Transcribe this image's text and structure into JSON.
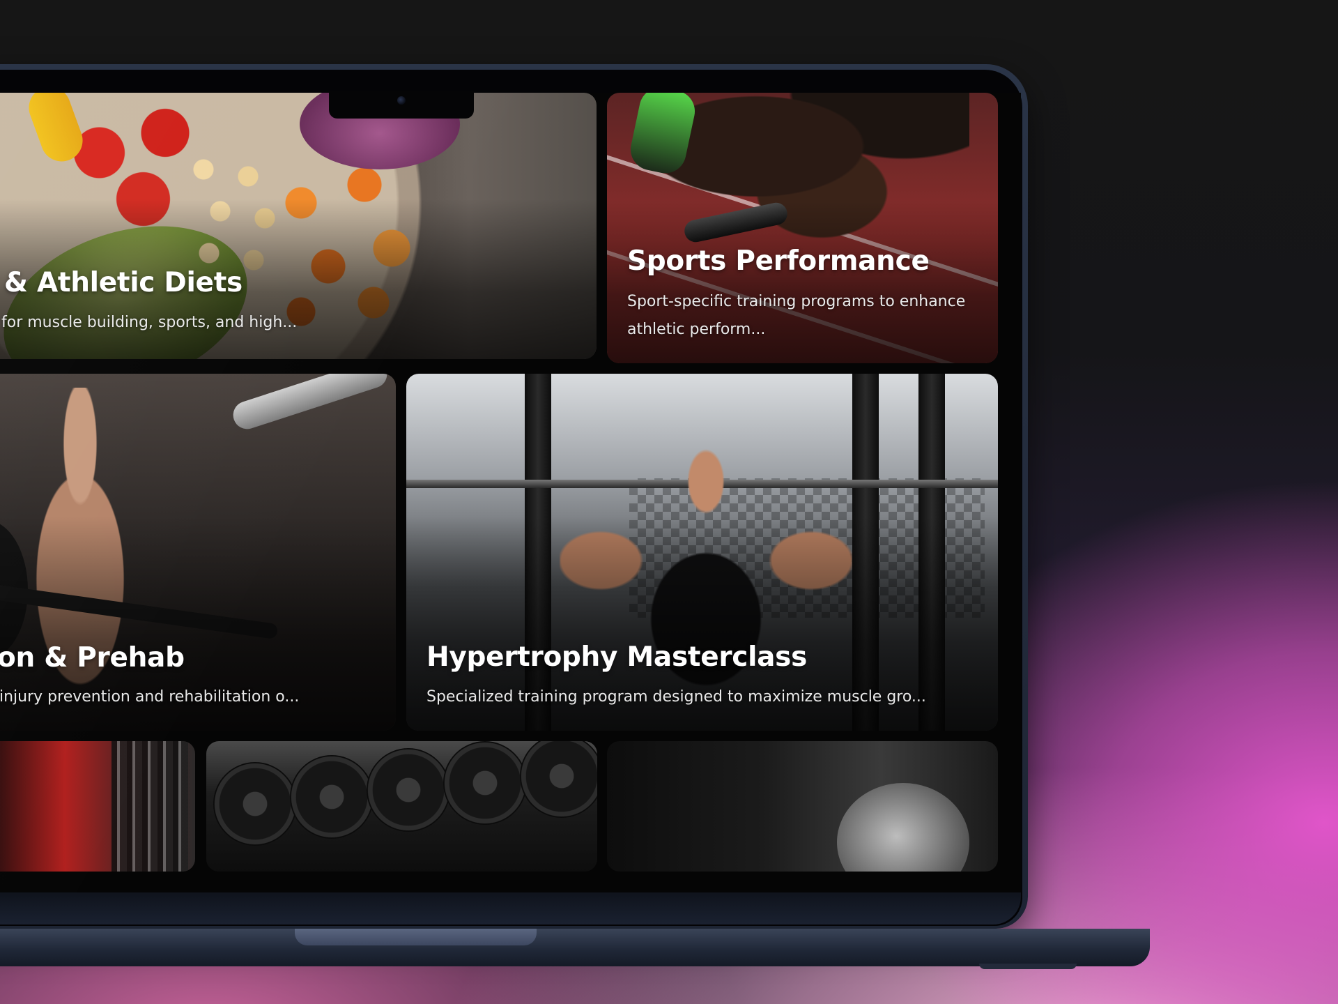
{
  "programs": [
    {
      "title": "& Athletic Diets",
      "description": "for muscle building, sports, and high..."
    },
    {
      "title": "Sports Performance",
      "description": "Sport-specific training programs to enhance athletic perform..."
    },
    {
      "title": "on & Prehab",
      "description": "injury prevention and rehabilitation o..."
    },
    {
      "title": "Hypertrophy Masterclass",
      "description": "Specialized training program designed to maximize muscle gro..."
    }
  ],
  "bottom_row": [
    {
      "image": "gym-rack-red-wall"
    },
    {
      "image": "dumbbell-rack"
    },
    {
      "image": "athlete-back-view"
    }
  ],
  "colors": {
    "background_accent": "#e055c9",
    "laptop_frame": "#1d2433",
    "screen_bg": "#050505"
  }
}
